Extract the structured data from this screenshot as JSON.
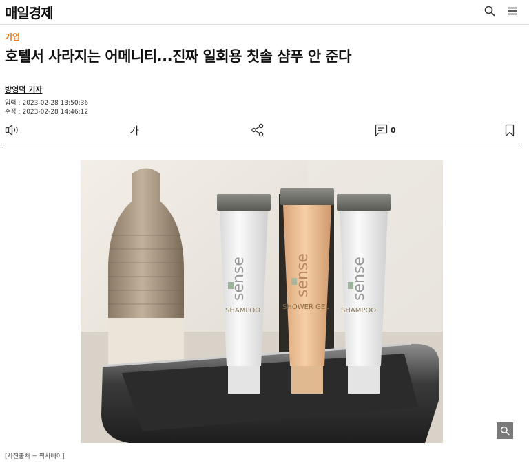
{
  "header": {
    "logo": "매일경제",
    "search_icon": "search-icon",
    "menu_icon": "hamburger-menu-icon"
  },
  "article": {
    "category": "기업",
    "title": "호텔서 사라지는 어메니티...진짜 일회용 칫솔 샴푸 안 준다",
    "author": "방영덕 기자",
    "published_label": "입력 :",
    "published": "2023-02-28 13:50:36",
    "updated_label": "수정 :",
    "updated": "2023-02-28 14:46:12"
  },
  "toolbar": {
    "listen_icon": "speaker-icon",
    "font_size_label": "가",
    "share_icon": "share-icon",
    "comment_icon": "comment-icon",
    "comment_count": "0",
    "bookmark_icon": "bookmark-icon"
  },
  "photo": {
    "tube_brand": "sense",
    "tube_labels": [
      "SHAMPOO",
      "SHOWER GEL",
      "SHAMPOO"
    ],
    "zoom_icon": "zoom-icon",
    "caption": "[사진출처 = 픽사베이]"
  },
  "colors": {
    "accent": "#e8771a",
    "text": "#111111"
  }
}
